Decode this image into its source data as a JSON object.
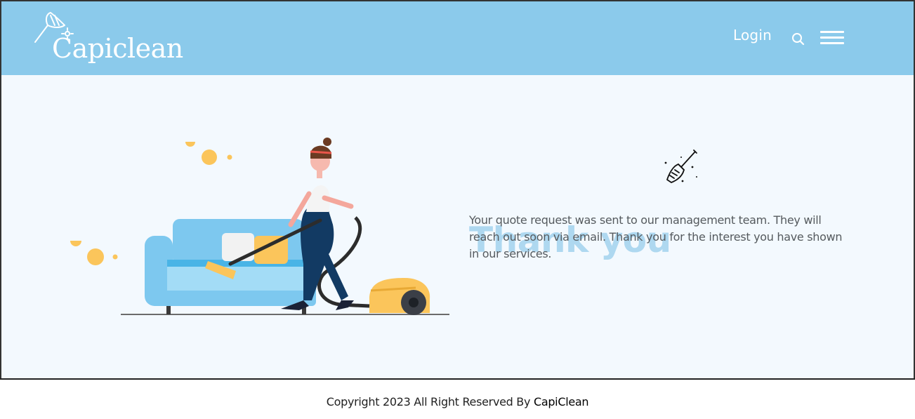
{
  "header": {
    "logo_text": "Capiclean",
    "login_label": "Login",
    "search_icon": "search-icon",
    "menu_icon": "hamburger-menu-icon"
  },
  "main": {
    "title": "Thank you",
    "title_icon": "broom-icon",
    "message": "Your quote request was sent to our management team. They will reach out soon via email. Thank you for the interest you have shown in our services.",
    "illustration": "woman-vacuuming-sofa-illustration"
  },
  "footer": {
    "copyright_prefix": "Copyright 2023 All Right Reserved By",
    "brand": "CapiClean"
  },
  "colors": {
    "header_bg": "#8bcaeb",
    "main_bg": "#f3f9fe",
    "title": "#aed8f0",
    "text": "#555a5e",
    "accent_yellow": "#fbc55b"
  }
}
